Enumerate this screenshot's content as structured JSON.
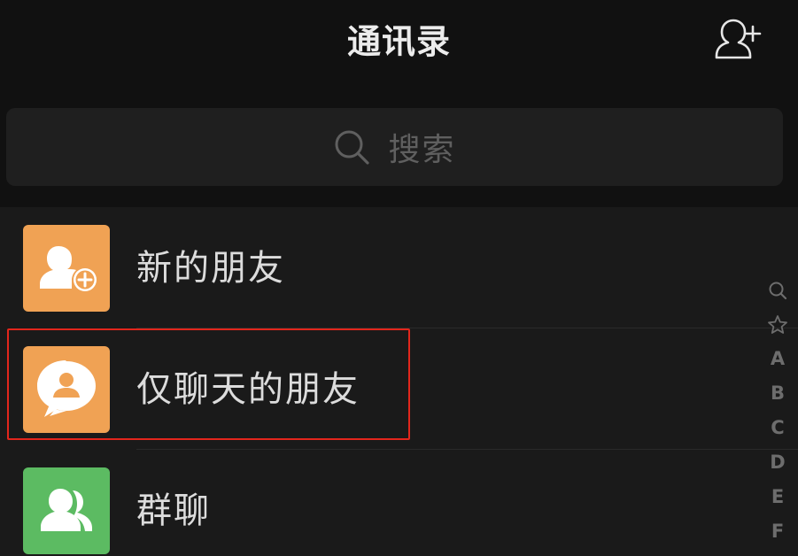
{
  "header": {
    "title": "通讯录"
  },
  "search": {
    "placeholder": "搜索"
  },
  "list": {
    "items": [
      {
        "label": "新的朋友",
        "icon": "add-friend-icon",
        "color": "#f0a254"
      },
      {
        "label": "仅聊天的朋友",
        "icon": "chat-only-friend-icon",
        "color": "#f0a254"
      },
      {
        "label": "群聊",
        "icon": "group-chat-icon",
        "color": "#5cbb62"
      }
    ]
  },
  "index_bar": {
    "letters": [
      "A",
      "B",
      "C",
      "D",
      "E",
      "F"
    ]
  },
  "colors": {
    "background": "#111111",
    "list_background": "#1a1a1a",
    "highlight": "#e2261c"
  }
}
